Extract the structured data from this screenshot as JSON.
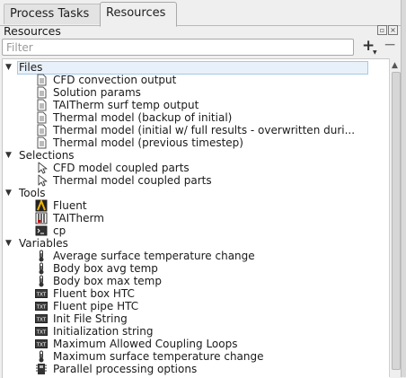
{
  "tabs": {
    "process_tasks": "Process Tasks",
    "resources": "Resources"
  },
  "panel": {
    "title": "Resources",
    "filter_placeholder": "Filter",
    "add_label": "+",
    "remove_label": "−"
  },
  "tree": {
    "categories": {
      "files": "Files",
      "selections": "Selections",
      "tools": "Tools",
      "variables": "Variables"
    },
    "files": [
      {
        "label": "CFD convection output",
        "icon": "document-icon"
      },
      {
        "label": "Solution params",
        "icon": "document-icon"
      },
      {
        "label": "TAITherm surf temp output",
        "icon": "document-icon"
      },
      {
        "label": "Thermal model (backup of initial)",
        "icon": "document-icon"
      },
      {
        "label": "Thermal model (initial w/ full results - overwritten duri...",
        "icon": "document-icon"
      },
      {
        "label": "Thermal model (previous timestep)",
        "icon": "document-icon"
      }
    ],
    "selections": [
      {
        "label": "CFD model coupled parts",
        "icon": "cursor-icon"
      },
      {
        "label": "Thermal model coupled parts",
        "icon": "cursor-icon"
      }
    ],
    "tools": [
      {
        "label": "Fluent",
        "icon": "fluent-icon"
      },
      {
        "label": "TAITherm",
        "icon": "taitherm-icon"
      },
      {
        "label": "cp",
        "icon": "terminal-icon"
      }
    ],
    "variables": [
      {
        "label": "Average surface temperature change",
        "icon": "thermometer-icon"
      },
      {
        "label": "Body box avg temp",
        "icon": "thermometer-icon"
      },
      {
        "label": "Body box max temp",
        "icon": "thermometer-icon"
      },
      {
        "label": "Fluent box HTC",
        "icon": "text-variable-icon"
      },
      {
        "label": "Fluent pipe HTC",
        "icon": "text-variable-icon"
      },
      {
        "label": "Init File String",
        "icon": "text-variable-icon"
      },
      {
        "label": "Initialization string",
        "icon": "text-variable-icon"
      },
      {
        "label": "Maximum Allowed Coupling Loops",
        "icon": "text-variable-icon"
      },
      {
        "label": "Maximum surface temperature change",
        "icon": "thermometer-icon"
      },
      {
        "label": "Parallel processing options",
        "icon": "processor-icon"
      }
    ]
  }
}
